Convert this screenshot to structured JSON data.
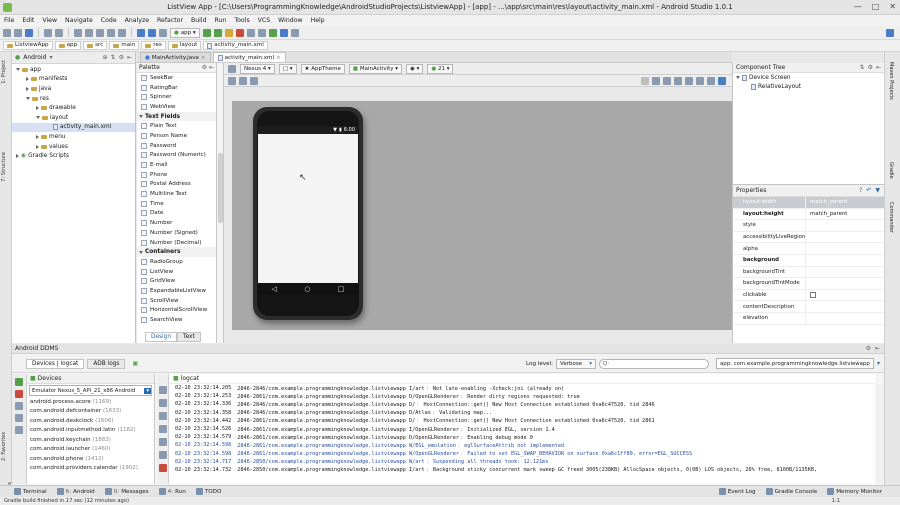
{
  "window": {
    "title": "ListView App - [C:\\Users\\ProgrammingKnowledge\\AndroidStudioProjects\\ListviewApp] - [app] - ...\\app\\src\\main\\res\\layout\\activity_main.xml - Android Studio 1.0.1"
  },
  "menu": [
    "File",
    "Edit",
    "View",
    "Navigate",
    "Code",
    "Analyze",
    "Refactor",
    "Build",
    "Run",
    "Tools",
    "VCS",
    "Window",
    "Help"
  ],
  "toolbar": {
    "run_config": "app"
  },
  "breadcrumb": [
    "ListviewApp",
    "app",
    "src",
    "main",
    "res",
    "layout",
    "activity_main.xml"
  ],
  "project": {
    "view_selector": "Android",
    "tree": [
      {
        "label": "app",
        "indent": 0,
        "kind": "folder",
        "open": true
      },
      {
        "label": "manifests",
        "indent": 1,
        "kind": "folder",
        "open": false
      },
      {
        "label": "java",
        "indent": 1,
        "kind": "folder",
        "open": false
      },
      {
        "label": "res",
        "indent": 1,
        "kind": "folder",
        "open": true
      },
      {
        "label": "drawable",
        "indent": 2,
        "kind": "folder",
        "open": false
      },
      {
        "label": "layout",
        "indent": 2,
        "kind": "folder",
        "open": true
      },
      {
        "label": "activity_main.xml",
        "indent": 3,
        "kind": "file",
        "selected": true
      },
      {
        "label": "menu",
        "indent": 2,
        "kind": "folder",
        "open": false
      },
      {
        "label": "values",
        "indent": 2,
        "kind": "folder",
        "open": false
      },
      {
        "label": "Gradle Scripts",
        "indent": 0,
        "kind": "gradle",
        "open": false
      }
    ]
  },
  "editor_tabs": [
    {
      "label": "MainActivity.java",
      "active": false
    },
    {
      "label": "activity_main.xml",
      "active": true
    }
  ],
  "palette": {
    "title": "Palette",
    "items": [
      {
        "type": "item",
        "label": "SeekBar"
      },
      {
        "type": "item",
        "label": "RatingBar"
      },
      {
        "type": "item",
        "label": "Spinner"
      },
      {
        "type": "item",
        "label": "WebView"
      },
      {
        "type": "group",
        "label": "Text Fields"
      },
      {
        "type": "item",
        "label": "Plain Text"
      },
      {
        "type": "item",
        "label": "Person Name"
      },
      {
        "type": "item",
        "label": "Password"
      },
      {
        "type": "item",
        "label": "Password (Numeric)"
      },
      {
        "type": "item",
        "label": "E-mail"
      },
      {
        "type": "item",
        "label": "Phone"
      },
      {
        "type": "item",
        "label": "Postal Address"
      },
      {
        "type": "item",
        "label": "Multiline Text"
      },
      {
        "type": "item",
        "label": "Time"
      },
      {
        "type": "item",
        "label": "Date"
      },
      {
        "type": "item",
        "label": "Number"
      },
      {
        "type": "item",
        "label": "Number (Signed)"
      },
      {
        "type": "item",
        "label": "Number (Decimal)"
      },
      {
        "type": "group",
        "label": "Containers"
      },
      {
        "type": "item",
        "label": "RadioGroup"
      },
      {
        "type": "item",
        "label": "ListView"
      },
      {
        "type": "item",
        "label": "GridView"
      },
      {
        "type": "item",
        "label": "ExpandableListView"
      },
      {
        "type": "item",
        "label": "ScrollView"
      },
      {
        "type": "item",
        "label": "HorizontalScrollView"
      },
      {
        "type": "item",
        "label": "SearchView"
      }
    ]
  },
  "canvas_toolbar": {
    "device": "Nexus 4",
    "theme": "AppTheme",
    "activity": "MainActivity",
    "api": "21"
  },
  "phone": {
    "clock": "6:00"
  },
  "design_tabs": {
    "design": "Design",
    "text": "Text"
  },
  "component_tree": {
    "title": "Component Tree",
    "root": "Device Screen",
    "child": "RelativeLayout"
  },
  "properties": {
    "title": "Properties",
    "rows": [
      {
        "k": "layout:width",
        "v": "match_parent",
        "style": "hdr"
      },
      {
        "k": "layout:height",
        "v": "match_parent",
        "style": "bold"
      },
      {
        "k": "style",
        "v": ""
      },
      {
        "k": "accessibilityLiveRegion",
        "v": ""
      },
      {
        "k": "alpha",
        "v": ""
      },
      {
        "k": "background",
        "v": "",
        "style": "bold"
      },
      {
        "k": "backgroundTint",
        "v": ""
      },
      {
        "k": "backgroundTintMode",
        "v": ""
      },
      {
        "k": "clickable",
        "v": "",
        "checkbox": true
      },
      {
        "k": "contentDescription",
        "v": ""
      },
      {
        "k": "elevation",
        "v": ""
      }
    ]
  },
  "ddms": {
    "title": "Android DDMS",
    "tab_devices": "Devices | logcat",
    "tab_adb": "ADB logs",
    "log_level_label": "Log level:",
    "log_level": "Verbose",
    "search_placeholder": "Q-",
    "app_filter": "app: com.example.programmingknowledge.listviewapp",
    "devices_header": "Devices",
    "emulator": "Emulator Nexus_5_API_21_x86 Android",
    "logcat_label": "logcat",
    "processes": [
      {
        "name": "android.process.acore",
        "pid": "(1169)"
      },
      {
        "name": "com.android.defcontainer",
        "pid": "(1633)"
      },
      {
        "name": "com.android.deskclock",
        "pid": "(1606)"
      },
      {
        "name": "com.android.inputmethod.latin",
        "pid": "(1182)"
      },
      {
        "name": "com.android.keychain",
        "pid": "(1883)"
      },
      {
        "name": "com.android.launcher",
        "pid": "(1460)"
      },
      {
        "name": "com.android.phone",
        "pid": "(1412)"
      },
      {
        "name": "com.android.providers.calendar",
        "pid": "(1902)"
      }
    ],
    "log": [
      {
        "t": "02-10 23:32:14.205",
        "m": "2846-2846/com.example.programmingknowledge.listviewapp I/art﹕ Not late-enabling -Xcheck:jni (already on)",
        "c": "info"
      },
      {
        "t": "02-10 23:32:14.253",
        "m": "2846-2861/com.example.programmingknowledge.listviewapp D/OpenGLRenderer﹕ Render dirty regions requested: true",
        "c": "info"
      },
      {
        "t": "02-10 23:32:14.336",
        "m": "2846-2846/com.example.programmingknowledge.listviewapp D/﹕ HostConnection::get() New Host Connection established 0xa6c47520, tid 2846",
        "c": "info"
      },
      {
        "t": "02-10 23:32:14.358",
        "m": "2846-2846/com.example.programmingknowledge.listviewapp D/Atlas﹕ Validating map...",
        "c": "info"
      },
      {
        "t": "02-10 23:32:14.442",
        "m": "2846-2861/com.example.programmingknowledge.listviewapp D/﹕ HostConnection::get() New Host Connection established 0xa6c47520, tid 2861",
        "c": "info"
      },
      {
        "t": "02-10 23:32:14.526",
        "m": "2846-2861/com.example.programmingknowledge.listviewapp I/OpenGLRenderer﹕ Initialized EGL, version 1.4",
        "c": "info"
      },
      {
        "t": "02-10 23:32:14.579",
        "m": "2846-2861/com.example.programmingknowledge.listviewapp D/OpenGLRenderer﹕ Enabling debug mode 0",
        "c": "info"
      },
      {
        "t": "02-10 23:32:14.598",
        "m": "2846-2861/com.example.programmingknowledge.listviewapp W/EGL_emulation﹕ eglSurfaceAttrib not implemented",
        "c": "dbg"
      },
      {
        "t": "02-10 23:32:14.598",
        "m": "2846-2861/com.example.programmingknowledge.listviewapp W/OpenGLRenderer﹕ Failed to set EGL_SWAP_BEHAVIOR on surface 0xa6c1ff80, error=EGL_SUCCESS",
        "c": "dbg"
      },
      {
        "t": "02-10 23:32:14.717",
        "m": "2846-2850/com.example.programmingknowledge.listviewapp W/art﹕ Suspending all threads took: 12.121ms",
        "c": "dbg"
      },
      {
        "t": "02-10 23:32:14.732",
        "m": "2846-2850/com.example.programmingknowledge.listviewapp I/art﹕ Background sticky concurrent mark sweep GC freed 3005(238KB) AllocSpace objects, 0(0B) LOS objects, 26% free, 8100B/1135KB,",
        "c": "info"
      }
    ]
  },
  "bottom_tabs": [
    {
      "num": "",
      "label": "Terminal"
    },
    {
      "num": "6:",
      "label": "Android"
    },
    {
      "num": "0:",
      "label": "Messages"
    },
    {
      "num": "4:",
      "label": "Run"
    },
    {
      "num": "",
      "label": "TODO"
    }
  ],
  "bottom_right_tabs": [
    "Event Log",
    "Gradle Console",
    "Memory Monitor"
  ],
  "status": {
    "text": "Gradle build finished in 17 sec (12 minutes ago)",
    "position": "1:1"
  },
  "colors": {
    "accent": "#2b6cb0",
    "canvas": "#a8a8a8",
    "run": "#56a04a"
  }
}
